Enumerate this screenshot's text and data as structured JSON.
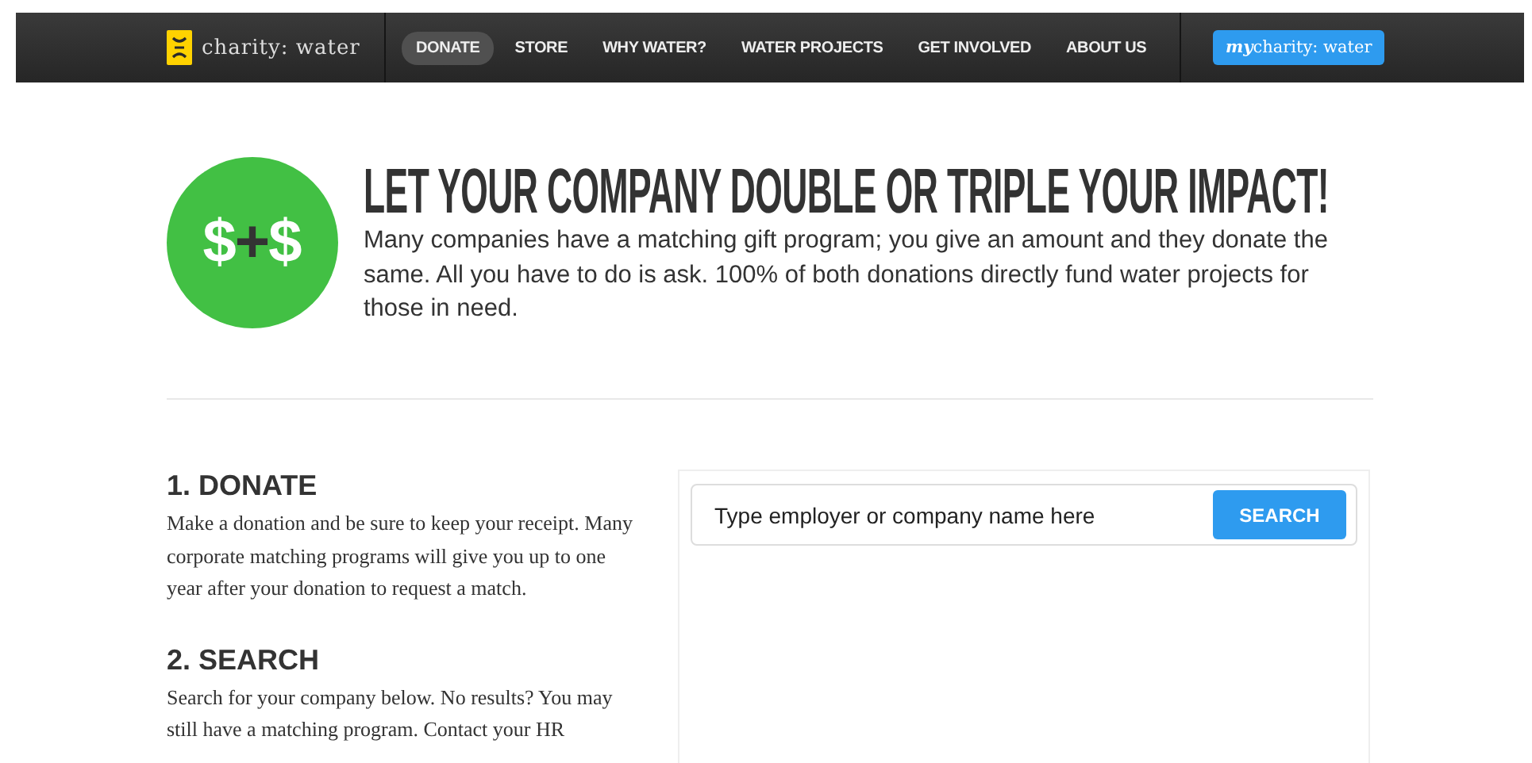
{
  "nav": {
    "logo": "charity: water",
    "items": [
      {
        "label": "DONATE",
        "selected": true
      },
      {
        "label": "STORE",
        "selected": false
      },
      {
        "label": "WHY WATER?",
        "selected": false
      },
      {
        "label": "WATER PROJECTS",
        "selected": false
      },
      {
        "label": "GET INVOLVED",
        "selected": false
      },
      {
        "label": "ABOUT US",
        "selected": false
      }
    ],
    "account_button": "**my**charity: water"
  },
  "hero": {
    "icon_text": "$+$",
    "title": "LET YOUR COMPANY DOUBLE OR TRIPLE YOUR IMPACT!",
    "text": "Many companies have a matching gift program; you give an amount and they donate the same. All you have to do is ask. 100% of both donations directly fund water projects for those in need."
  },
  "steps": [
    {
      "title": "1. DONATE",
      "text": "Make a donation and be sure to keep your receipt. Many corporate matching programs will give you up to one year after your donation to request a match."
    },
    {
      "title": "2. SEARCH",
      "text": "Search for your company below. No results? You may still have a matching program. Contact your HR"
    }
  ],
  "search": {
    "placeholder": "Type employer or company name here",
    "button": "SEARCH"
  }
}
